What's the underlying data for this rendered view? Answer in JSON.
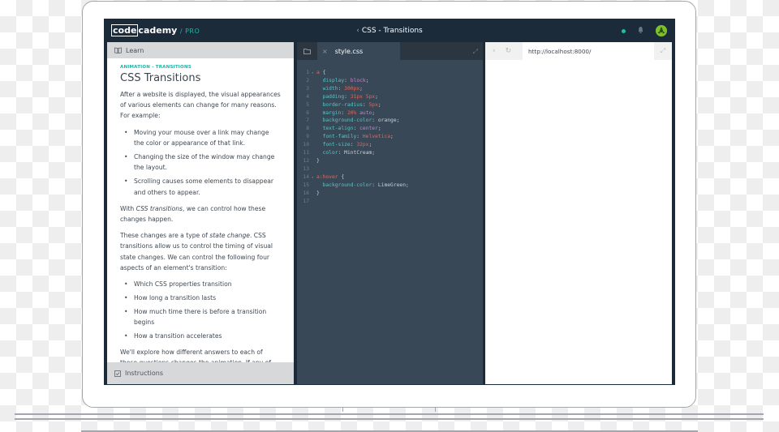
{
  "topbar": {
    "logo_code": "code",
    "logo_cademy": "cademy",
    "logo_pro": "/ PRO",
    "course_title": "CSS - Transitions",
    "back_chevron": "‹"
  },
  "learn": {
    "header_label": "Learn",
    "breadcrumb": "ANIMATION - TRANSITIONS",
    "title": "CSS Transitions",
    "intro": "After a website is displayed, the visual appearances of various elements can change for many reasons. For example:",
    "examples": [
      "Moving your mouse over a link may change the color or appearance of that link.",
      "Changing the size of the window may change the layout.",
      "Scrolling causes some elements to disappear and others to appear."
    ],
    "p2_before": "With ",
    "p2_em": "CSS transitions",
    "p2_after": ", we can control how these changes happen.",
    "p3_before": "These changes are a type of ",
    "p3_em": "state change",
    "p3_after": ". CSS transitions allow us to control the timing of visual state changes. We can control the following four aspects of an element's transition:",
    "aspects": [
      "Which CSS properties transition",
      "How long a transition lasts",
      "How much time there is before a transition begins",
      "How a transition accelerates"
    ],
    "p4": "We'll explore how different answers to each of these questions changes the animation. If any of these",
    "instructions_label": "Instructions"
  },
  "editor": {
    "file_tab": "style.css",
    "close": "×",
    "lines": [
      {
        "n": "1",
        "fold": "▾",
        "parts": [
          [
            "sel",
            "a"
          ],
          [
            "punc",
            " {"
          ]
        ]
      },
      {
        "n": "2",
        "fold": "",
        "parts": [
          [
            "plain",
            "  "
          ],
          [
            "prop",
            "display"
          ],
          [
            "punc",
            ": "
          ],
          [
            "kw",
            "block"
          ],
          [
            "punc",
            ";"
          ]
        ]
      },
      {
        "n": "3",
        "fold": "",
        "parts": [
          [
            "plain",
            "  "
          ],
          [
            "prop",
            "width"
          ],
          [
            "punc",
            ": "
          ],
          [
            "num",
            "300px"
          ],
          [
            "punc",
            ";"
          ]
        ]
      },
      {
        "n": "4",
        "fold": "",
        "parts": [
          [
            "plain",
            "  "
          ],
          [
            "prop",
            "padding"
          ],
          [
            "punc",
            ": "
          ],
          [
            "num",
            "31px 5px"
          ],
          [
            "punc",
            ";"
          ]
        ]
      },
      {
        "n": "5",
        "fold": "",
        "parts": [
          [
            "plain",
            "  "
          ],
          [
            "prop",
            "border-radius"
          ],
          [
            "punc",
            ": "
          ],
          [
            "num",
            "5px"
          ],
          [
            "punc",
            ";"
          ]
        ]
      },
      {
        "n": "6",
        "fold": "",
        "parts": [
          [
            "plain",
            "  "
          ],
          [
            "prop",
            "margin"
          ],
          [
            "punc",
            ": "
          ],
          [
            "num",
            "20%"
          ],
          [
            "punc",
            " "
          ],
          [
            "kw",
            "auto"
          ],
          [
            "punc",
            ";"
          ]
        ]
      },
      {
        "n": "7",
        "fold": "",
        "parts": [
          [
            "plain",
            "  "
          ],
          [
            "prop",
            "background-color"
          ],
          [
            "punc",
            ": "
          ],
          [
            "plain",
            "orange"
          ],
          [
            "punc",
            ";"
          ]
        ]
      },
      {
        "n": "8",
        "fold": "",
        "parts": [
          [
            "plain",
            "  "
          ],
          [
            "prop",
            "text-align"
          ],
          [
            "punc",
            ": "
          ],
          [
            "kw",
            "center"
          ],
          [
            "punc",
            ";"
          ]
        ]
      },
      {
        "n": "9",
        "fold": "",
        "parts": [
          [
            "plain",
            "  "
          ],
          [
            "prop",
            "font-family"
          ],
          [
            "punc",
            ": "
          ],
          [
            "num",
            "Helvetica"
          ],
          [
            "punc",
            ";"
          ]
        ]
      },
      {
        "n": "10",
        "fold": "",
        "parts": [
          [
            "plain",
            "  "
          ],
          [
            "prop",
            "font-size"
          ],
          [
            "punc",
            ": "
          ],
          [
            "num",
            "32px"
          ],
          [
            "punc",
            ";"
          ]
        ]
      },
      {
        "n": "11",
        "fold": "",
        "parts": [
          [
            "plain",
            "  "
          ],
          [
            "prop",
            "color"
          ],
          [
            "punc",
            ": "
          ],
          [
            "plain",
            "MintCream"
          ],
          [
            "punc",
            ";"
          ]
        ]
      },
      {
        "n": "12",
        "fold": "",
        "parts": [
          [
            "punc",
            "}"
          ]
        ]
      },
      {
        "n": "13",
        "fold": "",
        "parts": []
      },
      {
        "n": "14",
        "fold": "▾",
        "parts": [
          [
            "sel",
            "a:hover"
          ],
          [
            "punc",
            " {"
          ]
        ]
      },
      {
        "n": "15",
        "fold": "",
        "parts": [
          [
            "plain",
            "  "
          ],
          [
            "prop",
            "background-color"
          ],
          [
            "punc",
            ": "
          ],
          [
            "plain",
            "LimeGreen"
          ],
          [
            "punc",
            ";"
          ]
        ]
      },
      {
        "n": "16",
        "fold": "",
        "parts": [
          [
            "punc",
            "}"
          ]
        ]
      },
      {
        "n": "17",
        "fold": "",
        "parts": []
      }
    ]
  },
  "browser": {
    "back": "‹",
    "refresh": "↻",
    "url": "http://localhost:8000/",
    "expand": "⤢"
  }
}
